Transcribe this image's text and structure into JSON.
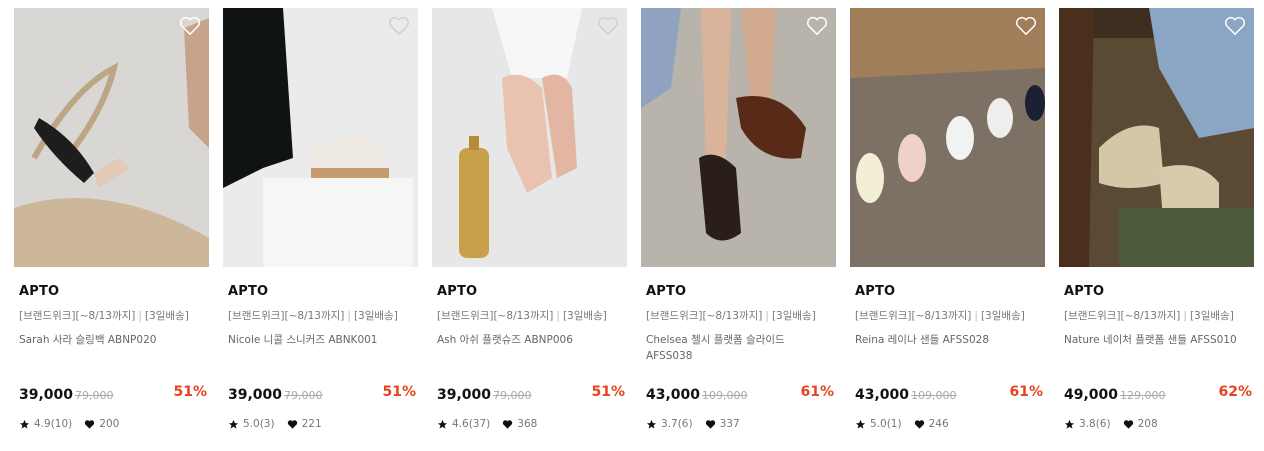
{
  "products": [
    {
      "brand": "APTO",
      "tag": "[브랜드위크][~8/13까지]",
      "tag2": "[3일배송]",
      "name": "Sarah 사라 슬링백 ABNP020",
      "price": "39,000",
      "original_price": "79,000",
      "discount": "51%",
      "rating": "4.9(10)",
      "likes": "200",
      "bg": "#d8d6d3"
    },
    {
      "brand": "APTO",
      "tag": "[브랜드위크][~8/13까지]",
      "tag2": "[3일배송]",
      "name": "Nicole 니콜 스니커즈 ABNK001",
      "price": "39,000",
      "original_price": "79,000",
      "discount": "51%",
      "rating": "5.0(3)",
      "likes": "221",
      "bg": "#e9e9ea"
    },
    {
      "brand": "APTO",
      "tag": "[브랜드위크][~8/13까지]",
      "tag2": "[3일배송]",
      "name": "Ash 아쉬 플랫슈즈 ABNP006",
      "price": "39,000",
      "original_price": "79,000",
      "discount": "51%",
      "rating": "4.6(37)",
      "likes": "368",
      "bg": "#e6e6e6"
    },
    {
      "brand": "APTO",
      "tag": "[브랜드위크][~8/13까지]",
      "tag2": "[3일배송]",
      "name": "Chelsea 첼시 플랫폼 슬라이드 AFSS038",
      "price": "43,000",
      "original_price": "109,000",
      "discount": "61%",
      "rating": "3.7(6)",
      "likes": "337",
      "bg": "#b9b4ac"
    },
    {
      "brand": "APTO",
      "tag": "[브랜드위크][~8/13까지]",
      "tag2": "[3일배송]",
      "name": "Reina 레이나 샌들 AFSS028",
      "price": "43,000",
      "original_price": "109,000",
      "discount": "61%",
      "rating": "5.0(1)",
      "likes": "246",
      "bg": "#7b6e63"
    },
    {
      "brand": "APTO",
      "tag": "[브랜드위크][~8/13까지]",
      "tag2": "[3일배송]",
      "name": "Nature 네이처 플랫폼 샌들 AFSS010",
      "price": "49,000",
      "original_price": "129,000",
      "discount": "62%",
      "rating": "3.8(6)",
      "likes": "208",
      "bg": "#6b5a3e"
    }
  ],
  "colors": {
    "discount": "#e8431e",
    "brand": "#111111",
    "meta": "#777777"
  },
  "icons": {
    "wishlist": "heart-outline-icon",
    "rating": "star-icon",
    "likes": "heart-filled-icon"
  }
}
